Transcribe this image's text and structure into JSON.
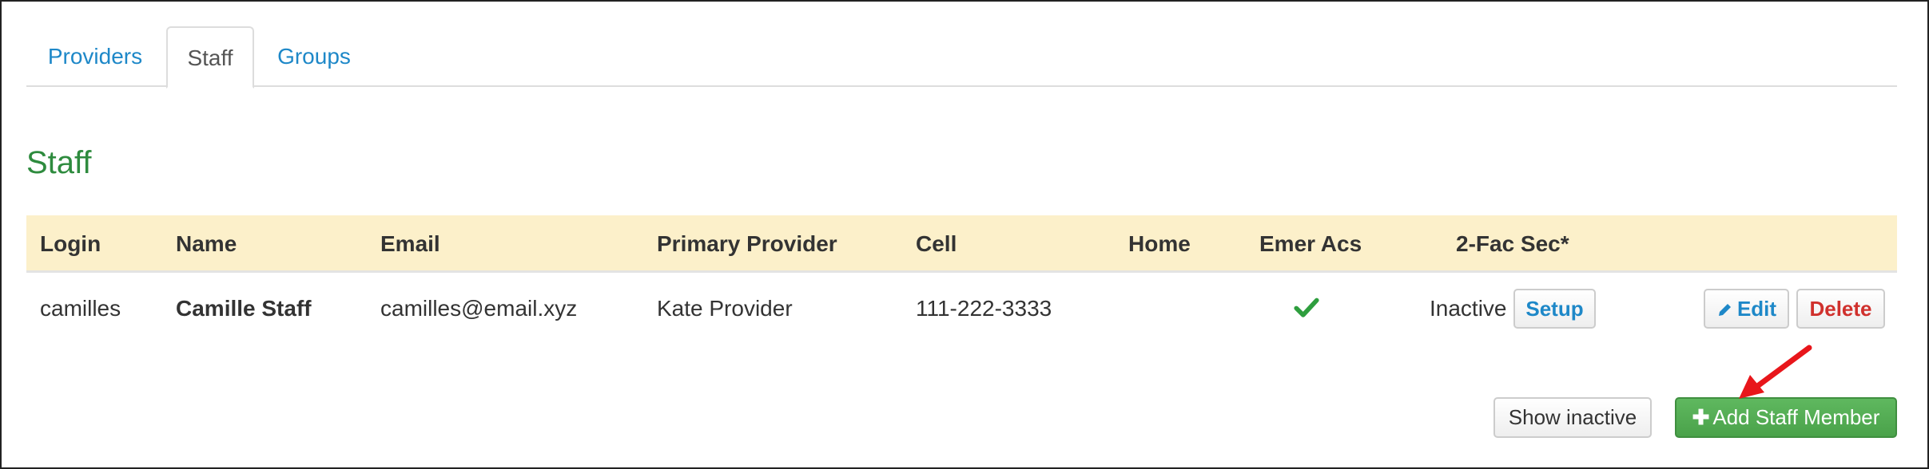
{
  "tabs": [
    {
      "label": "Providers"
    },
    {
      "label": "Staff"
    },
    {
      "label": "Groups"
    }
  ],
  "section_title": "Staff",
  "table": {
    "headers": {
      "login": "Login",
      "name": "Name",
      "email": "Email",
      "primary_provider": "Primary Provider",
      "cell": "Cell",
      "home": "Home",
      "emer_acs": "Emer Acs",
      "two_fac": "2-Fac Sec*"
    },
    "rows": [
      {
        "login": "camilles",
        "name": "Camille Staff",
        "email": "camilles@email.xyz",
        "primary_provider": "Kate Provider",
        "cell": "111-222-3333",
        "home": "",
        "emer_acs": "check-icon",
        "two_fac_status": "Inactive",
        "setup_label": "Setup",
        "edit_label": "Edit",
        "delete_label": "Delete"
      }
    ]
  },
  "actions": {
    "show_inactive_label": "Show inactive",
    "add_staff_label": "Add Staff Member"
  },
  "colors": {
    "link": "#1e88c8",
    "title_green": "#2e8b3e",
    "header_bg": "#fcf0ca",
    "delete_red": "#d0312d",
    "add_button_green": "#4aa24a",
    "annotation_arrow": "#e8161b"
  }
}
